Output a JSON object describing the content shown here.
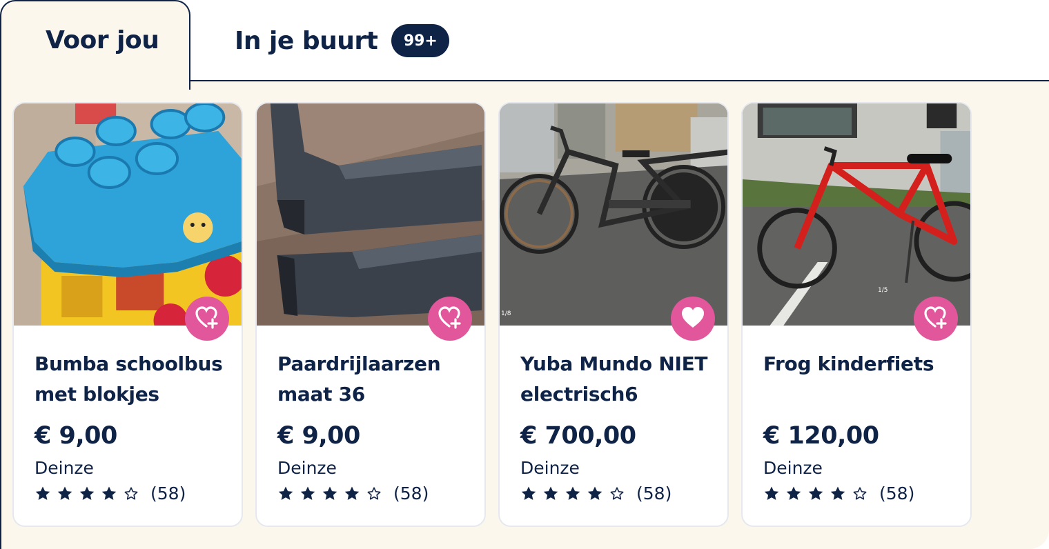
{
  "tabs": [
    {
      "label": "Voor jou",
      "active": true
    },
    {
      "label": "In je buurt",
      "badge": "99+",
      "active": false
    }
  ],
  "colors": {
    "navy": "#0f2347",
    "panel_bg": "#fcf7ec",
    "favorite_pink": "#e2579c",
    "card_border": "#e6e8ef"
  },
  "listings": [
    {
      "title": "Bumba schoolbus met blokjes",
      "price": "€ 9,00",
      "location": "Deinze",
      "rating_stars": 4,
      "rating_max": 5,
      "review_count": "(58)",
      "favorited": false,
      "photo_counter": "",
      "favorite_icon": "heart-plus-icon"
    },
    {
      "title": "Paardrijlaarzen maat 36",
      "price": "€ 9,00",
      "location": "Deinze",
      "rating_stars": 4,
      "rating_max": 5,
      "review_count": "(58)",
      "favorited": false,
      "photo_counter": "",
      "favorite_icon": "heart-plus-icon"
    },
    {
      "title": "Yuba Mundo NIET electrisch6",
      "price": "€ 700,00",
      "location": "Deinze",
      "rating_stars": 4,
      "rating_max": 5,
      "review_count": "(58)",
      "favorited": true,
      "photo_counter": "1/8",
      "favorite_icon": "heart-filled-icon"
    },
    {
      "title": "Frog kinderfiets",
      "price": "€ 120,00",
      "location": "Deinze",
      "rating_stars": 4,
      "rating_max": 5,
      "review_count": "(58)",
      "favorited": false,
      "photo_counter": "1/5",
      "favorite_icon": "heart-plus-icon"
    }
  ]
}
